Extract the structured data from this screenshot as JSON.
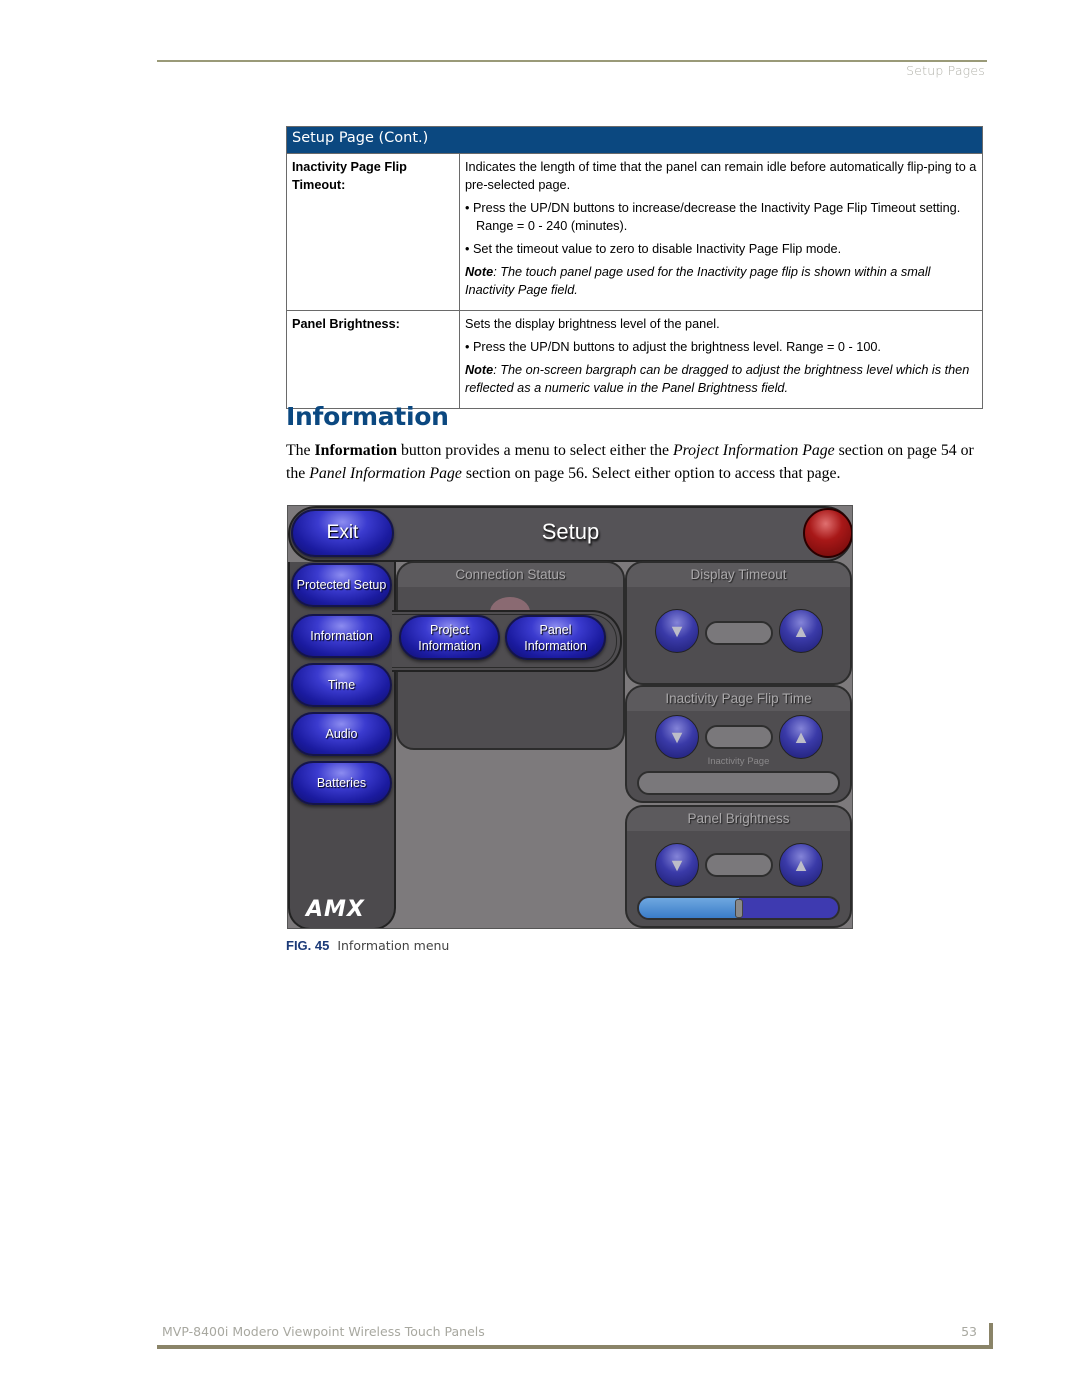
{
  "header": {
    "running_head": "Setup Pages"
  },
  "table": {
    "title": "Setup Page (Cont.)",
    "rows": [
      {
        "label": "Inactivity Page Flip Timeout:",
        "paragraphs": [
          "Indicates the length of time that the panel can remain idle before automatically flip-ping to a pre-selected page."
        ],
        "bullets": [
          "Press the UP/DN buttons to increase/decrease the Inactivity Page Flip Timeout setting. Range = 0 - 240 (minutes).",
          "Set the timeout value to zero to disable Inactivity Page Flip mode."
        ],
        "note_label": "Note",
        "note_text": ": The touch panel page used for the Inactivity page flip is shown within a small Inactivity Page field."
      },
      {
        "label": "Panel Brightness:",
        "paragraphs": [
          "Sets the display brightness level of the panel."
        ],
        "bullets": [
          "Press the UP/DN buttons to adjust the brightness level. Range = 0 - 100."
        ],
        "note_label": "Note",
        "note_text": ": The on-screen bargraph can be dragged to adjust the brightness level which is then reflected as a numeric value in the Panel Brightness field."
      }
    ]
  },
  "section": {
    "title": "Information",
    "body": {
      "t1": "The ",
      "b1": "Information",
      "t2": " button provides a menu to select either the ",
      "i1": "Project Information Page",
      "t3": " section on page 54 or the ",
      "i2": "Panel Information Page",
      "t4": " section on page 56. Select either option to access that page."
    }
  },
  "screenshot": {
    "exit_label": "Exit",
    "title": "Setup",
    "sidebar": [
      {
        "label": "Protected Setup"
      },
      {
        "label": "Information"
      },
      {
        "label": "Time"
      },
      {
        "label": "Audio"
      },
      {
        "label": "Batteries"
      }
    ],
    "logo": "AMX",
    "connection_status_title": "Connection Status",
    "submenu": [
      {
        "label": "Project Information"
      },
      {
        "label": "Panel Information"
      }
    ],
    "display_timeout_title": "Display Timeout",
    "inactivity_title": "Inactivity Page Flip Time",
    "inactivity_page_label": "Inactivity Page",
    "brightness_title": "Panel Brightness",
    "brightness_level_percent": 50,
    "down_arrow": "▼",
    "up_arrow": "▲",
    "colors": {
      "button_blue": "#2a2ab8",
      "status_red": "#a81818",
      "panel_gray": "#4f4d50"
    }
  },
  "figure": {
    "number": "FIG. 45",
    "caption": "Information menu"
  },
  "footer": {
    "product": "MVP-8400i Modero Viewpoint Wireless Touch Panels",
    "page": "53"
  },
  "colors": {
    "heading_blue": "#0b4880",
    "rule_olive": "#9a9a78"
  }
}
